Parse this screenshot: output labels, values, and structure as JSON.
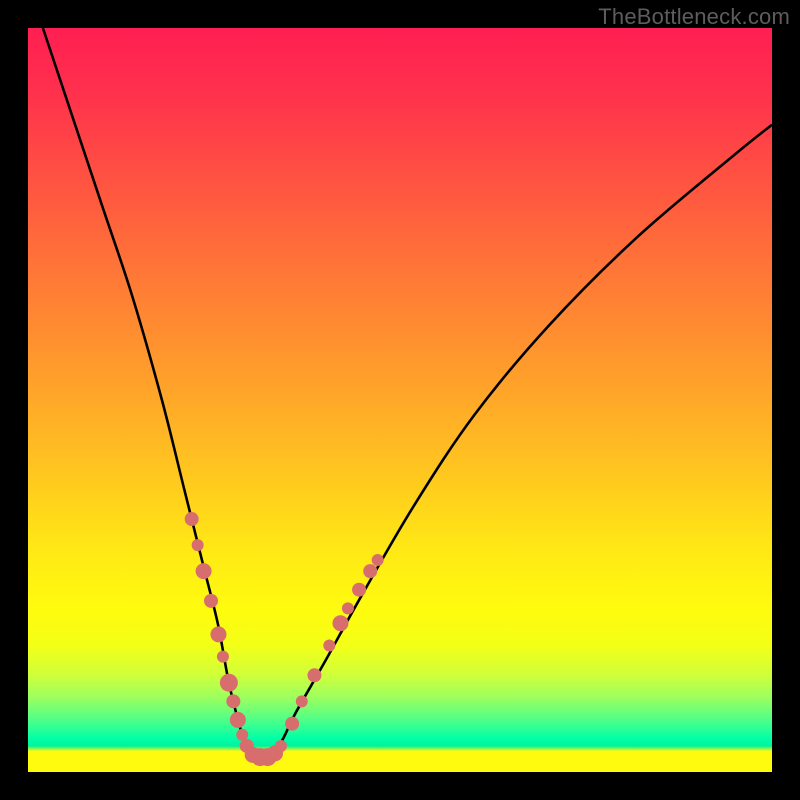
{
  "watermark": "TheBottleneck.com",
  "chart_data": {
    "type": "line",
    "title": "",
    "xlabel": "",
    "ylabel": "",
    "xlim": [
      0,
      100
    ],
    "ylim": [
      0,
      100
    ],
    "grid": false,
    "series": [
      {
        "name": "bottleneck-curve",
        "x": [
          2,
          6,
          10,
          14,
          18,
          21,
          23.5,
          25.5,
          27,
          28.5,
          29.5,
          30.5,
          32,
          34,
          36,
          40,
          45,
          52,
          60,
          70,
          82,
          95,
          100
        ],
        "y": [
          100,
          88,
          76,
          64,
          50,
          38,
          28,
          20,
          12,
          6,
          3,
          2,
          2,
          4,
          8,
          15,
          24,
          36,
          48,
          60,
          72,
          83,
          87
        ]
      }
    ],
    "markers": {
      "name": "highlighted-points",
      "color": "#d86d6d",
      "points": [
        {
          "x": 22.0,
          "y": 34.0,
          "r": 7
        },
        {
          "x": 22.8,
          "y": 30.5,
          "r": 6
        },
        {
          "x": 23.6,
          "y": 27.0,
          "r": 8
        },
        {
          "x": 24.6,
          "y": 23.0,
          "r": 7
        },
        {
          "x": 25.6,
          "y": 18.5,
          "r": 8
        },
        {
          "x": 26.2,
          "y": 15.5,
          "r": 6
        },
        {
          "x": 27.0,
          "y": 12.0,
          "r": 9
        },
        {
          "x": 27.6,
          "y": 9.5,
          "r": 7
        },
        {
          "x": 28.2,
          "y": 7.0,
          "r": 8
        },
        {
          "x": 28.8,
          "y": 5.0,
          "r": 6
        },
        {
          "x": 29.4,
          "y": 3.5,
          "r": 7
        },
        {
          "x": 30.2,
          "y": 2.3,
          "r": 8
        },
        {
          "x": 31.2,
          "y": 2.0,
          "r": 9
        },
        {
          "x": 32.2,
          "y": 2.0,
          "r": 9
        },
        {
          "x": 33.2,
          "y": 2.5,
          "r": 8
        },
        {
          "x": 34.0,
          "y": 3.5,
          "r": 6
        },
        {
          "x": 35.5,
          "y": 6.5,
          "r": 7
        },
        {
          "x": 36.8,
          "y": 9.5,
          "r": 6
        },
        {
          "x": 38.5,
          "y": 13.0,
          "r": 7
        },
        {
          "x": 40.5,
          "y": 17.0,
          "r": 6
        },
        {
          "x": 42.0,
          "y": 20.0,
          "r": 8
        },
        {
          "x": 43.0,
          "y": 22.0,
          "r": 6
        },
        {
          "x": 44.5,
          "y": 24.5,
          "r": 7
        },
        {
          "x": 46.0,
          "y": 27.0,
          "r": 7
        },
        {
          "x": 47.0,
          "y": 28.5,
          "r": 6
        }
      ]
    }
  }
}
